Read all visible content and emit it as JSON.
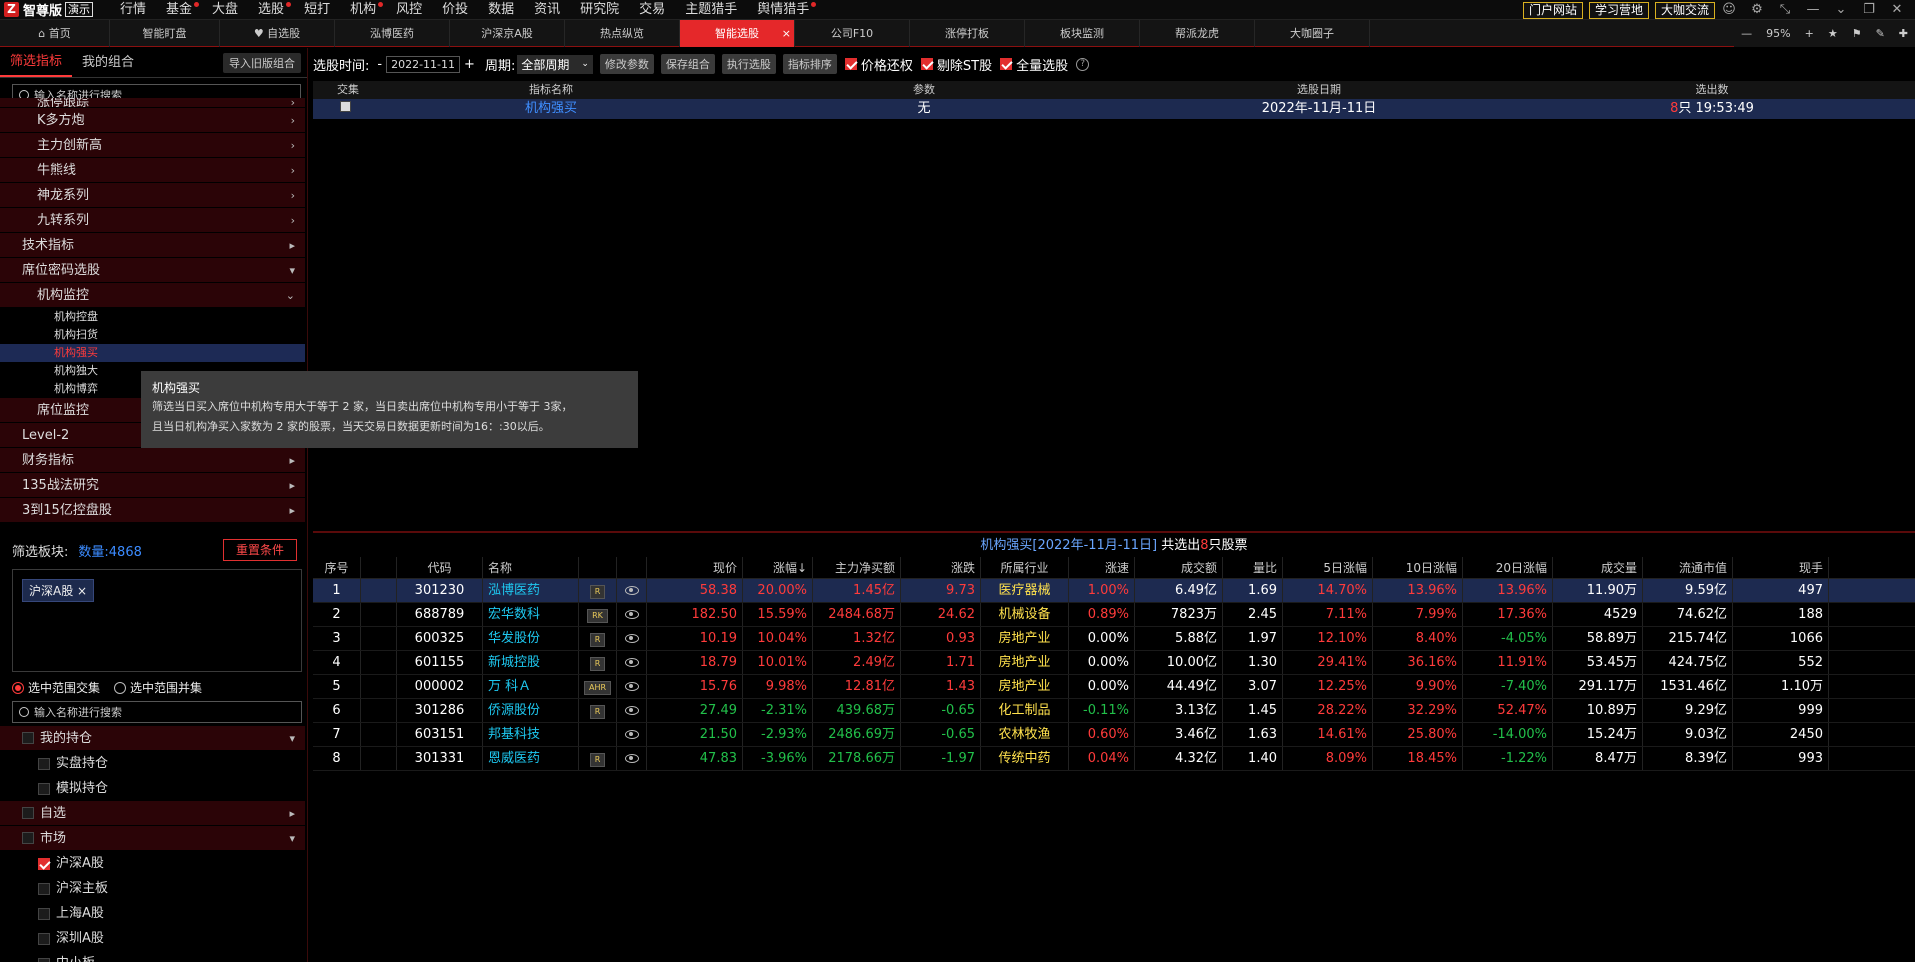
{
  "app": {
    "logo_mark": "Z",
    "logo_name": "智尊版",
    "logo_badge": "演示"
  },
  "top_menu": [
    {
      "label": "行情",
      "dot": false
    },
    {
      "label": "基金",
      "dot": true
    },
    {
      "label": "大盘",
      "dot": false
    },
    {
      "label": "选股",
      "dot": true
    },
    {
      "label": "短打",
      "dot": false
    },
    {
      "label": "机构",
      "dot": true
    },
    {
      "label": "风控",
      "dot": false
    },
    {
      "label": "价投",
      "dot": false
    },
    {
      "label": "数据",
      "dot": false
    },
    {
      "label": "资讯",
      "dot": false
    },
    {
      "label": "研究院",
      "dot": false
    },
    {
      "label": "交易",
      "dot": false
    },
    {
      "label": "主题猎手",
      "dot": false
    },
    {
      "label": "舆情猎手",
      "dot": true
    }
  ],
  "top_right_buttons": [
    "门户网站",
    "学习营地",
    "大咖交流"
  ],
  "tabs": [
    "首页",
    "智能盯盘",
    "自选股",
    "泓博医药",
    "沪深京A股",
    "热点纵览",
    "智能选股",
    "公司F10",
    "涨停打板",
    "板块监测",
    "帮派龙虎",
    "大咖圈子"
  ],
  "active_tab": "智能选股",
  "zoom": {
    "minus": "—",
    "value": "95%",
    "plus": "+"
  },
  "left": {
    "tab_active": "筛选指标",
    "tab2": "我的组合",
    "import_btn": "导入旧版组合",
    "search_placeholder": "输入名称进行搜索",
    "tree": [
      {
        "label": "涨停跟踪",
        "lv": "lv2",
        "arrow": "›"
      },
      {
        "label": "K多方炮",
        "lv": "lv2",
        "arrow": "›"
      },
      {
        "label": "主力创新高",
        "lv": "lv2",
        "arrow": "›"
      },
      {
        "label": "牛熊线",
        "lv": "lv2",
        "arrow": "›"
      },
      {
        "label": "神龙系列",
        "lv": "lv2",
        "arrow": "›"
      },
      {
        "label": "九转系列",
        "lv": "lv2",
        "arrow": "›"
      },
      {
        "label": "技术指标",
        "lv": "lv1",
        "arrow": "▸"
      },
      {
        "label": "席位密码选股",
        "lv": "lv1",
        "arrow": "▾"
      },
      {
        "label": "机构监控",
        "lv": "lv2",
        "arrow": "⌄"
      },
      {
        "label": "机构控盘",
        "lv": "lv3",
        "arrow": ""
      },
      {
        "label": "机构扫货",
        "lv": "lv3",
        "arrow": ""
      },
      {
        "label": "机构强买",
        "lv": "lv3 sel",
        "arrow": ""
      },
      {
        "label": "机构独大",
        "lv": "lv3",
        "arrow": ""
      },
      {
        "label": "机构博弈",
        "lv": "lv3",
        "arrow": ""
      },
      {
        "label": "席位监控",
        "lv": "lv2",
        "arrow": "›"
      },
      {
        "label": "Level-2",
        "lv": "lv1",
        "arrow": "▸"
      },
      {
        "label": "财务指标",
        "lv": "lv1",
        "arrow": "▸"
      },
      {
        "label": "135战法研究",
        "lv": "lv1",
        "arrow": "▸"
      },
      {
        "label": "3到15亿控盘股",
        "lv": "lv1",
        "arrow": "▸"
      }
    ],
    "filter_label": "筛选板块:",
    "count_label": "数量:4868",
    "reset_btn": "重置条件",
    "chip": "沪深A股",
    "chip_close": "×",
    "radio1": "选中范围交集",
    "radio2": "选中范围并集",
    "search2_placeholder": "输入名称进行搜索",
    "tree2": [
      {
        "label": "我的持仓",
        "type": "hdr",
        "cb": false,
        "arrow": "▾"
      },
      {
        "label": "实盘持仓",
        "type": "sub",
        "cb": false,
        "arrow": ""
      },
      {
        "label": "模拟持仓",
        "type": "sub",
        "cb": false,
        "arrow": ""
      },
      {
        "label": "自选",
        "type": "hdr",
        "cb": false,
        "arrow": "▸"
      },
      {
        "label": "市场",
        "type": "hdr",
        "cb": false,
        "arrow": "▾"
      },
      {
        "label": "沪深A股",
        "type": "sub",
        "cb": true,
        "arrow": ""
      },
      {
        "label": "沪深主板",
        "type": "sub",
        "cb": false,
        "arrow": ""
      },
      {
        "label": "上海A股",
        "type": "sub",
        "cb": false,
        "arrow": ""
      },
      {
        "label": "深圳A股",
        "type": "sub",
        "cb": false,
        "arrow": ""
      },
      {
        "label": "中小板",
        "type": "sub",
        "cb": false,
        "arrow": ""
      }
    ]
  },
  "tooltip": {
    "title": "机构强买",
    "line1": "筛选当日买入席位中机构专用大于等于 2 家，当日卖出席位中机构专用小于等于 3家，",
    "line2": "且当日机构净买入家数为 2 家的股票，当天交易日数据更新时间为16：:30以后。"
  },
  "toolbar": {
    "date_label": "选股时间:",
    "minus": "-",
    "date": "2022-11-11",
    "plus": "+",
    "period_label": "周期:",
    "period": "全部周期",
    "buttons": [
      "修改参数",
      "保存组合",
      "执行选股",
      "指标排序"
    ],
    "chk1": "价格还权",
    "chk2": "剔除ST股",
    "chk3": "全量选股"
  },
  "top_table": {
    "headers": [
      "交集",
      "指标名称",
      "参数",
      "选股日期",
      "选出数"
    ],
    "row": {
      "name": "机构强买",
      "param": "无",
      "date": "2022年-11月-11日",
      "count": "8",
      "count_suffix": "只 19:53:49"
    }
  },
  "result_title": {
    "prefix": "机构强买[2022年-11月-11日]",
    "mid": " 共选出",
    "count": "8",
    "suffix": "只股票"
  },
  "grid": {
    "headers": [
      "序号",
      "",
      "代码",
      "名称",
      "",
      "",
      "现价",
      "涨幅↓",
      "主力净买额",
      "涨跌",
      "所属行业",
      "涨速",
      "成交额",
      "量比",
      "5日涨幅",
      "10日涨幅",
      "20日涨幅",
      "成交量",
      "流通市值",
      "现手"
    ],
    "rows": [
      [
        "1",
        "",
        "301230",
        "泓博医药",
        "R",
        "",
        "58.38",
        "20.00%",
        "1.45亿",
        "9.73",
        "医疗器械",
        "1.00%",
        "6.49亿",
        "1.69",
        "14.70%",
        "13.96%",
        "13.96%",
        "11.90万",
        "9.59亿",
        "497"
      ],
      [
        "2",
        "",
        "688789",
        "宏华数科",
        "RK",
        "",
        "182.50",
        "15.59%",
        "2484.68万",
        "24.62",
        "机械设备",
        "0.89%",
        "7823万",
        "2.45",
        "7.11%",
        "7.99%",
        "17.36%",
        "4529",
        "74.62亿",
        "188"
      ],
      [
        "3",
        "",
        "600325",
        "华发股份",
        "R",
        "",
        "10.19",
        "10.04%",
        "1.32亿",
        "0.93",
        "房地产业",
        "0.00%",
        "5.88亿",
        "1.97",
        "12.10%",
        "8.40%",
        "-4.05%",
        "58.89万",
        "215.74亿",
        "1066"
      ],
      [
        "4",
        "",
        "601155",
        "新城控股",
        "R",
        "",
        "18.79",
        "10.01%",
        "2.49亿",
        "1.71",
        "房地产业",
        "0.00%",
        "10.00亿",
        "1.30",
        "29.41%",
        "36.16%",
        "11.91%",
        "53.45万",
        "424.75亿",
        "552"
      ],
      [
        "5",
        "",
        "000002",
        "万 科Ａ",
        "AHR",
        "",
        "15.76",
        "9.98%",
        "12.81亿",
        "1.43",
        "房地产业",
        "0.00%",
        "44.49亿",
        "3.07",
        "12.25%",
        "9.90%",
        "-7.40%",
        "291.17万",
        "1531.46亿",
        "1.10万"
      ],
      [
        "6",
        "",
        "301286",
        "侨源股份",
        "R",
        "",
        "27.49",
        "-2.31%",
        "439.68万",
        "-0.65",
        "化工制品",
        "-0.11%",
        "3.13亿",
        "1.45",
        "28.22%",
        "32.29%",
        "52.47%",
        "10.89万",
        "9.29亿",
        "999"
      ],
      [
        "7",
        "",
        "603151",
        "邦基科技",
        "",
        "",
        "21.50",
        "-2.93%",
        "2486.69万",
        "-0.65",
        "农林牧渔",
        "0.60%",
        "3.46亿",
        "1.63",
        "14.61%",
        "25.80%",
        "-14.00%",
        "15.24万",
        "9.03亿",
        "2450"
      ],
      [
        "8",
        "",
        "301331",
        "恩威医药",
        "R",
        "",
        "47.83",
        "-3.96%",
        "2178.66万",
        "-1.97",
        "传统中药",
        "0.04%",
        "4.32亿",
        "1.40",
        "8.09%",
        "18.45%",
        "-1.22%",
        "8.47万",
        "8.39亿",
        "993"
      ]
    ]
  }
}
